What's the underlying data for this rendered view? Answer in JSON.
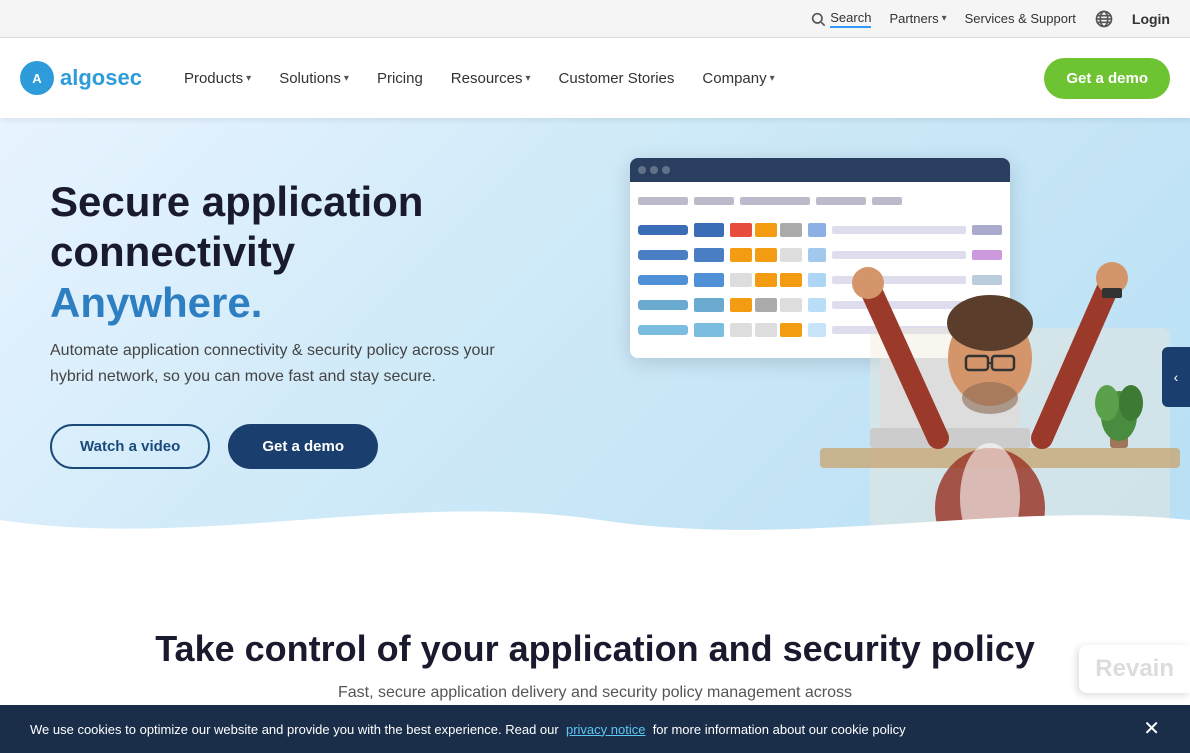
{
  "topbar": {
    "search_label": "Search",
    "partners_label": "Partners",
    "services_label": "Services & Support",
    "login_label": "Login"
  },
  "nav": {
    "logo_text_plain": "algo",
    "logo_text_accent": "sec",
    "products_label": "Products",
    "solutions_label": "Solutions",
    "pricing_label": "Pricing",
    "resources_label": "Resources",
    "customer_stories_label": "Customer Stories",
    "company_label": "Company",
    "get_demo_label": "Get a demo"
  },
  "hero": {
    "title_line1": "Secure application connectivity",
    "title_line2": "Anywhere.",
    "subtitle": "Automate application connectivity & security policy across your hybrid network, so you can move fast and stay secure.",
    "btn_video_label": "Watch a video",
    "btn_demo_label": "Get a demo"
  },
  "section": {
    "title": "Take control of your application and security policy",
    "subtitle": "Fast, secure application delivery and security policy management across"
  },
  "cookie": {
    "text": "We use cookies to optimize our website and provide you with the best experience. Read our",
    "link_text": "privacy notice",
    "text_after": "for more information about our cookie policy"
  },
  "revain": {
    "text": "Revain"
  }
}
